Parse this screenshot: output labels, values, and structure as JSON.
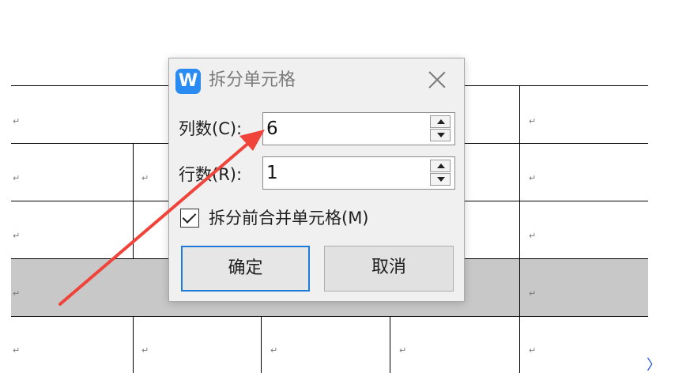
{
  "document": {
    "paragraph_mark": "↵",
    "corner_glyph": "〉"
  },
  "dialog": {
    "app_icon_letter": "W",
    "title": "拆分单元格",
    "columns": {
      "label": "列数(C):",
      "value": "6"
    },
    "rows": {
      "label": "行数(R):",
      "value": "1"
    },
    "merge_checkbox": {
      "label": "拆分前合并单元格(M)",
      "checked": true
    },
    "ok_label": "确定",
    "cancel_label": "取消"
  },
  "colors": {
    "accent": "#1f7bd8",
    "annotation_arrow": "#f0443a",
    "selection_shade": "#c8c8c8"
  }
}
